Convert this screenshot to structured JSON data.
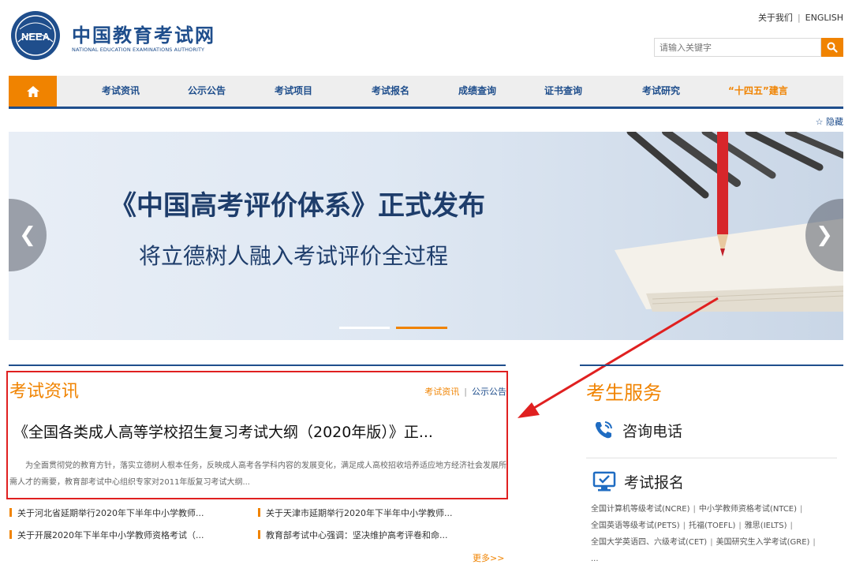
{
  "header": {
    "logo_seal_text": "NEEA",
    "logo_cn": "中国教育考试网",
    "logo_en": "NATIONAL EDUCATION EXAMINATIONS AUTHORITY",
    "about": "关于我们",
    "english": "ENGLISH",
    "search_placeholder": "请输入关键字"
  },
  "nav": {
    "items": [
      "考试资讯",
      "公示公告",
      "考试项目",
      "考试报名",
      "成绩查询",
      "证书查询",
      "考试研究",
      "“十四五”建言"
    ],
    "hide_label": "☆ 隐藏"
  },
  "banner": {
    "title": "《中国高考评价体系》正式发布",
    "subtitle": "将立德树人融入考试评价全过程",
    "active_slide": 2,
    "slide_count": 2
  },
  "news": {
    "heading": "考试资讯",
    "tabs": [
      "考试资讯",
      "公示公告"
    ],
    "headline": "《全国各类成人高等学校招生复习考试大纲（2020年版）》正...",
    "summary": "为全面贯彻党的教育方针，落实立德树人根本任务，反映成人高考各学科内容的发展变化，满足成人高校招收培养适应地方经济社会发展所需人才的需要，教育部考试中心组织专家对2011年版复习考试大纲...",
    "items": [
      "关于河北省延期举行2020年下半年中小学教师...",
      "关于天津市延期举行2020年下半年中小学教师...",
      "关于开展2020年下半年中小学教师资格考试（...",
      "教育部考试中心强调：坚决维护高考评卷和命..."
    ],
    "more": "更多>>"
  },
  "services": {
    "heading": "考生服务",
    "phone_label": "咨询电话",
    "register_label": "考试报名",
    "exam_links_line1": [
      "全国计算机等级考试(NCRE)",
      "中小学教师资格考试(NTCE)"
    ],
    "exam_links_line2": [
      "全国英语等级考试(PETS)",
      "托福(TOEFL)",
      "雅思(IELTS)"
    ],
    "exam_links_line3": [
      "全国大学英语四、六级考试(CET)",
      "美国研究生入学考试(GRE)"
    ],
    "exam_links_more": "..."
  },
  "colors": {
    "brand_blue": "#1f4e8c",
    "accent_orange": "#f08300",
    "highlight_red": "#e02020"
  }
}
